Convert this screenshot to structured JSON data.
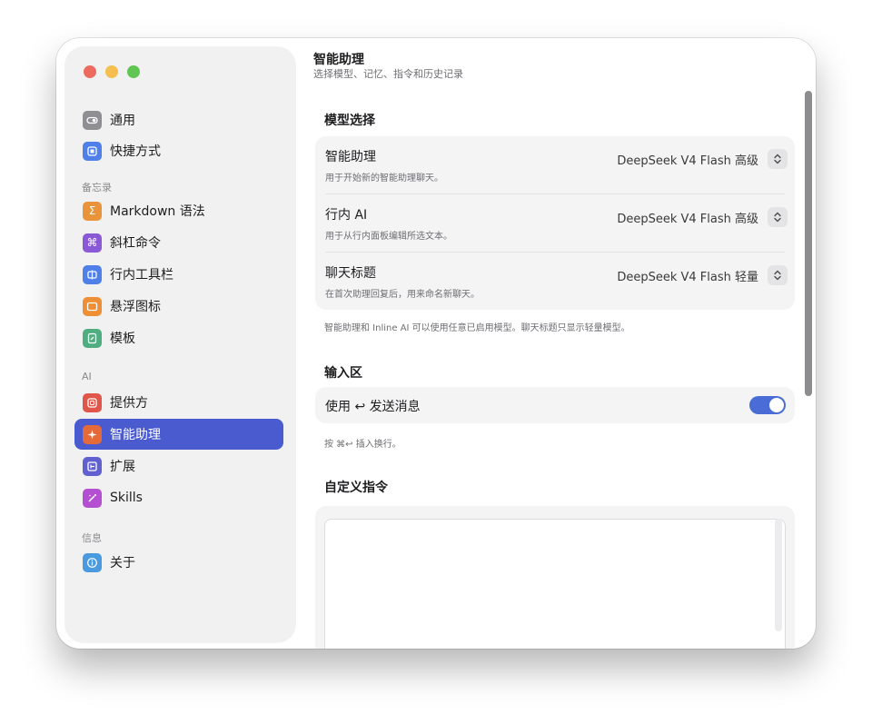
{
  "window": {
    "traffic_lights": [
      "close",
      "minimize",
      "zoom"
    ]
  },
  "sidebar": {
    "items_top": [
      {
        "label": "通用",
        "icon": "toggle-icon",
        "color": "#8e8e93"
      },
      {
        "label": "快捷方式",
        "icon": "keyboard-icon",
        "color": "#4f7fe8"
      }
    ],
    "memo_header": "备忘录",
    "memo_items": [
      {
        "label": "Markdown 语法",
        "icon": "sigma-icon",
        "color": "#e9933a"
      },
      {
        "label": "斜杠命令",
        "icon": "command-icon",
        "color": "#8a59d6"
      },
      {
        "label": "行内工具栏",
        "icon": "toolbar-icon",
        "color": "#4f7fe8"
      },
      {
        "label": "悬浮图标",
        "icon": "window-icon",
        "color": "#ee8f35"
      },
      {
        "label": "模板",
        "icon": "template-icon",
        "color": "#4fae7f"
      }
    ],
    "ai_header": "AI",
    "ai_items": [
      {
        "label": "提供方",
        "icon": "provider-icon",
        "color": "#e0564a"
      },
      {
        "label": "智能助理",
        "icon": "sparkle-icon",
        "color": "#e56a3a",
        "active": true
      },
      {
        "label": "扩展",
        "icon": "extension-icon",
        "color": "#6060d0"
      },
      {
        "label": "Skills",
        "icon": "magic-wand-icon",
        "color": "#b34fd0"
      }
    ],
    "info_header": "信息",
    "info_items": [
      {
        "label": "关于",
        "icon": "info-icon",
        "color": "#4a9ae0"
      }
    ],
    "active_color": "#4a5bd0"
  },
  "main": {
    "title": "智能助理",
    "subtitle": "选择模型、记忆、指令和历史记录",
    "model_section": {
      "title": "模型选择",
      "rows": [
        {
          "title": "智能助理",
          "desc": "用于开始新的智能助理聊天。",
          "value": "DeepSeek V4 Flash 高级"
        },
        {
          "title": "行内 AI",
          "desc": "用于从行内面板编辑所选文本。",
          "value": "DeepSeek V4 Flash 高级"
        },
        {
          "title": "聊天标题",
          "desc": "在首次助理回复后，用来命名新聊天。",
          "value": "DeepSeek V4 Flash 轻量"
        }
      ],
      "note": "智能助理和 Inline AI 可以使用任意已启用模型。聊天标题只显示轻量模型。"
    },
    "input_section": {
      "title": "输入区",
      "toggle_label": "使用 ↩ 发送消息",
      "toggle_on": true,
      "note": "按 ⌘↩ 插入换行。"
    },
    "instructions_section": {
      "title": "自定义指令",
      "text": ""
    }
  }
}
